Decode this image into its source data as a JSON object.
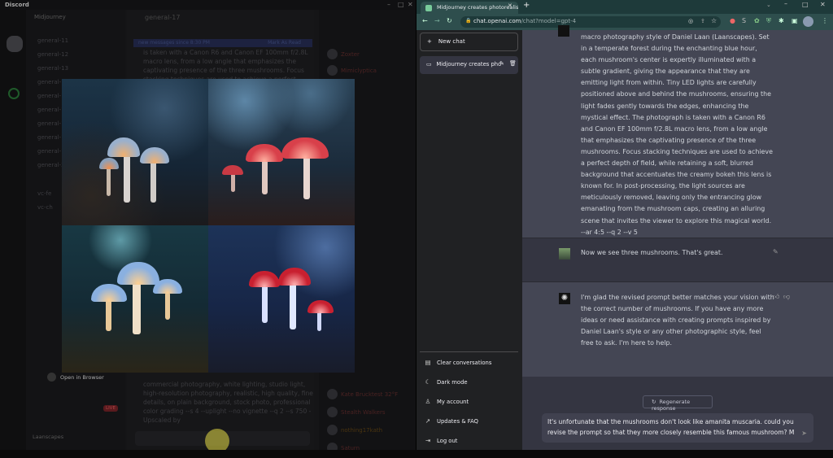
{
  "discord": {
    "app_title": "Discord",
    "server_name": "Midjourney",
    "channel_header": "general-17",
    "channels": [
      "general-11",
      "general-12",
      "general-13",
      "general-14",
      "general-15",
      "general-16",
      "general-17",
      "general-18",
      "general-19",
      "general-20"
    ],
    "voice_channels": [
      "vc-fe",
      "vc-ch"
    ],
    "new_messages_banner": "new messages since 8:30 PM",
    "mark_as_read": "Mark As Read",
    "message_top": "is taken with a Canon R6 and Canon EF 100mm f/2.8L macro lens, from a low angle that emphasizes the captivating presence of the three mushrooms. Focus stacking techniques are used to achieve a perfect depth of field",
    "message_bottom": "commercial photography, white lighting, studio light, high-resolution photography, realistic, high quality, fine details, on plain background, stock photo, professional color grading --s 4 --uplight --no vignette --q 2 --s 750 - Upscaled by",
    "open_in_browser": "Open in Browser",
    "live_badge": "LIVE",
    "username": "Laanscapes",
    "members": [
      "Zoxter",
      "Mimiclyptica",
      "Kate Brucktest 32°F",
      "Stealth Walkers",
      "nothing17kath",
      "Saturn"
    ]
  },
  "browser": {
    "tab_title": "Midjourney creates photorealistic",
    "url_host": "chat.openai.com",
    "url_path": "/chat?model=gpt-4",
    "accent": "#2e4e4d"
  },
  "chatgpt": {
    "new_chat": "New chat",
    "conversation": "Midjourney creates pho",
    "menu": [
      {
        "icon": "trash-icon",
        "label": "Clear conversations"
      },
      {
        "icon": "moon-icon",
        "label": "Dark mode"
      },
      {
        "icon": "user-icon",
        "label": "My account"
      },
      {
        "icon": "external-link-icon",
        "label": "Updates & FAQ"
      },
      {
        "icon": "logout-icon",
        "label": "Log out"
      }
    ],
    "messages": [
      {
        "role": "assistant",
        "text": "macro photography style of Daniel Laan (Laanscapes). Set in a temperate forest during the enchanting blue hour, each mushroom's center is expertly illuminated with a subtle gradient, giving the appearance that they are emitting light from within. Tiny LED lights are carefully positioned above and behind the mushrooms, ensuring the light fades gently towards the edges, enhancing the mystical effect. The photograph is taken with a Canon R6 and Canon EF 100mm f/2.8L macro lens, from a low angle that emphasizes the captivating presence of the three mushrooms. Focus stacking techniques are used to achieve a perfect depth of field, while retaining a soft, blurred background that accentuates the creamy bokeh this lens is known for. In post-processing, the light sources are meticulously removed, leaving only the entrancing glow emanating from the mushroom caps, creating an alluring scene that invites the viewer to explore this magical world. --ar 4:5 --q 2 --v 5"
      },
      {
        "role": "user",
        "text": "Now we see three mushrooms. That's great."
      },
      {
        "role": "assistant",
        "text": "I'm glad the revised prompt better matches your vision with the correct number of mushrooms. If you have any more ideas or need assistance with creating prompts inspired by Daniel Laan's style or any other photographic style, feel free to ask. I'm here to help."
      }
    ],
    "regenerate": "Regenerate response",
    "input_value": "It's unfortunate that the mushrooms don't look like amanita muscaria. could you revise the prompt so that they more closely resemble this famous mushroom? M"
  }
}
